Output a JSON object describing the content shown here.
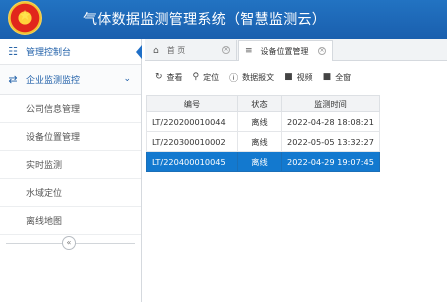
{
  "header": {
    "title": "气体数据监测管理系统（智慧监测云）",
    "emblem": "national-emblem"
  },
  "sidebar": {
    "dashboard_label": "管理控制台",
    "section_label": "企业监测监控",
    "items": [
      "公司信息管理",
      "设备位置管理",
      "实时监测",
      "水域定位",
      "离线地图"
    ],
    "collapse_glyph": "«"
  },
  "tabs": [
    {
      "label": "首  页",
      "icon": "home-icon"
    },
    {
      "label": "设备位置管理",
      "icon": "list-icon"
    }
  ],
  "toolbar": {
    "view": "查看",
    "locate": "定位",
    "report": "数据报文",
    "video": "视频",
    "fullscreen": "全窗"
  },
  "table": {
    "headers": [
      "编号",
      "状态",
      "监测时间"
    ],
    "rows": [
      {
        "id": "LT/220200010044",
        "status": "离线",
        "time": "2022-04-28 18:08:21",
        "selected": false
      },
      {
        "id": "LT/220300010002",
        "status": "离线",
        "time": "2022-05-05 13:32:27",
        "selected": false
      },
      {
        "id": "LT/220400010045",
        "status": "离线",
        "time": "2022-04-29 19:07:45",
        "selected": true
      }
    ]
  },
  "colors": {
    "header_bg": "#1a5fae",
    "selected_row": "#1379cf",
    "accent": "#1f5fa8"
  }
}
